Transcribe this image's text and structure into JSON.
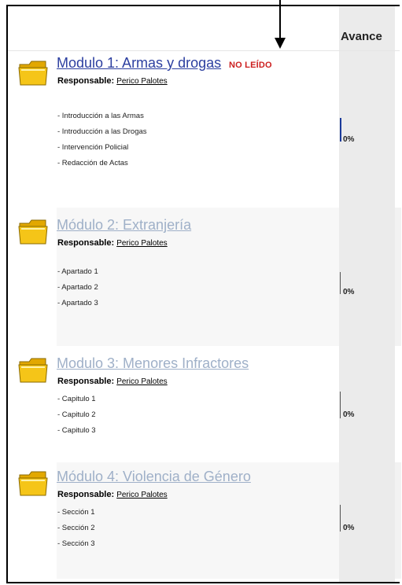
{
  "table": {
    "progress_header": "Avance"
  },
  "modules": [
    {
      "title": "Modulo 1: Armas y drogas",
      "badge": "NO LEÍDO",
      "responsible_label": "Responsable:",
      "responsible": "Perico Palotes",
      "items": [
        "- Introducción a las Armas",
        "- Introducción a las Drogas",
        "- Intervención Policial",
        "- Redacción de Actas"
      ],
      "progress": "0%",
      "progress_value": 0,
      "state": "active"
    },
    {
      "title": "Módulo 2: Extranjería",
      "responsible_label": "Responsable:",
      "responsible": "Perico Palotes",
      "items": [
        "- Apartado 1",
        "- Apartado 2",
        "- Apartado 3"
      ],
      "progress": "0%",
      "progress_value": 0,
      "state": "inactive"
    },
    {
      "title": "Modulo 3: Menores Infractores",
      "responsible_label": "Responsable:",
      "responsible": "Perico Palotes",
      "items": [
        "- Capitulo 1",
        "- Capitulo 2",
        "- Capitulo 3"
      ],
      "progress": "0%",
      "progress_value": 0,
      "state": "inactive"
    },
    {
      "title": "Módulo 4: Violencia de Género",
      "responsible_label": "Responsable:",
      "responsible": "Perico Palotes",
      "items": [
        "- Sección 1",
        "- Sección 2",
        "- Sección 3"
      ],
      "progress": "0%",
      "progress_value": 0,
      "state": "inactive"
    }
  ],
  "colors": {
    "active_link": "#2c3fa0",
    "inactive_link": "#9fb0c8",
    "badge": "#cc1f1f",
    "folder": "#f5c518"
  },
  "icons": {
    "module_icon": "folder-icon",
    "annotation": "arrow-down-icon"
  }
}
